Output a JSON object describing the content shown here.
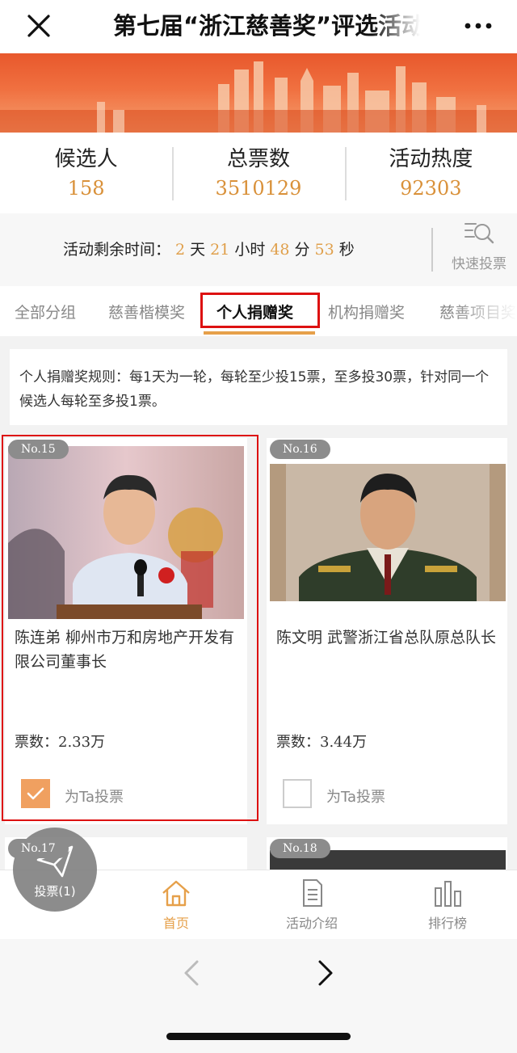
{
  "header": {
    "title": "第七届“浙江慈善奖”评选活动"
  },
  "stats": [
    {
      "label": "候选人",
      "value": "158"
    },
    {
      "label": "总票数",
      "value": "3510129"
    },
    {
      "label": "活动热度",
      "value": "92303"
    }
  ],
  "countdown": {
    "label": "活动剩余时间：",
    "days": "2",
    "days_unit": "天",
    "hours": "21",
    "hours_unit": "小时",
    "minutes": "48",
    "minutes_unit": "分",
    "seconds": "53",
    "seconds_unit": "秒"
  },
  "quick_vote": {
    "label": "快速投票"
  },
  "tabs": [
    {
      "label": "全部分组"
    },
    {
      "label": "慈善楷模奖"
    },
    {
      "label": "个人捐赠奖",
      "active": true
    },
    {
      "label": "机构捐赠奖"
    },
    {
      "label": "慈善项目奖"
    }
  ],
  "rules": {
    "text": "个人捐赠奖规则：每1天为一轮，每轮至少投15票，至多投30票，针对同一个候选人每轮至多投1票。"
  },
  "candidates": [
    {
      "no": "No.15",
      "name": "陈连弟 柳州市万和房地产开发有限公司董事长",
      "votes_label": "票数：",
      "votes": "2.33万",
      "vote_label": "为Ta投票",
      "selected": true
    },
    {
      "no": "No.16",
      "name": "陈文明 武警浙江省总队原总队长",
      "votes_label": "票数：",
      "votes": "3.44万",
      "vote_label": "为Ta投票",
      "selected": false
    }
  ],
  "next_candidates": [
    {
      "no": "No.17"
    },
    {
      "no": "No.18"
    }
  ],
  "fab": {
    "label": "投票(1)"
  },
  "tabbar": [
    {
      "label": "首页",
      "icon": "home-icon",
      "active": true
    },
    {
      "label": "活动介绍",
      "icon": "document-icon"
    },
    {
      "label": "排行榜",
      "icon": "bar-chart-icon"
    }
  ],
  "colors": {
    "accent": "#e6a04a",
    "highlight": "#dd1111",
    "banner": "#ec6434"
  }
}
